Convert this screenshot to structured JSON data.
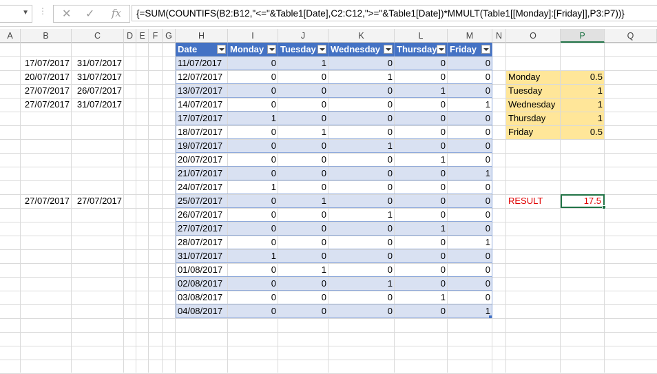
{
  "namebox": {
    "value": ""
  },
  "formula_bar": {
    "icons": [
      "cancel-icon",
      "enter-icon",
      "function-icon"
    ],
    "formula": "{=SUM(COUNTIFS(B2:B12,\"<=\"&Table1[Date],C2:C12,\">=\"&Table1[Date])*MMULT(Table1[[Monday]:[Friday]],P3:P7))}"
  },
  "columns": [
    "A",
    "B",
    "C",
    "D",
    "E",
    "F",
    "G",
    "H",
    "I",
    "J",
    "K",
    "L",
    "M",
    "N",
    "O",
    "P",
    "Q"
  ],
  "selected_column": "P",
  "ranges": [
    {
      "start": "17/07/2017",
      "end": "31/07/2017"
    },
    {
      "start": "20/07/2017",
      "end": "31/07/2017"
    },
    {
      "start": "27/07/2017",
      "end": "26/07/2017"
    },
    {
      "start": "27/07/2017",
      "end": "31/07/2017"
    },
    {
      "start": "27/07/2017",
      "end": "27/07/2017"
    }
  ],
  "table": {
    "headers": [
      "Date",
      "Monday",
      "Tuesday",
      "Wednesday",
      "Thursday",
      "Friday"
    ],
    "rows": [
      [
        "11/07/2017",
        "0",
        "1",
        "0",
        "0",
        "0"
      ],
      [
        "12/07/2017",
        "0",
        "0",
        "1",
        "0",
        "0"
      ],
      [
        "13/07/2017",
        "0",
        "0",
        "0",
        "1",
        "0"
      ],
      [
        "14/07/2017",
        "0",
        "0",
        "0",
        "0",
        "1"
      ],
      [
        "17/07/2017",
        "1",
        "0",
        "0",
        "0",
        "0"
      ],
      [
        "18/07/2017",
        "0",
        "1",
        "0",
        "0",
        "0"
      ],
      [
        "19/07/2017",
        "0",
        "0",
        "1",
        "0",
        "0"
      ],
      [
        "20/07/2017",
        "0",
        "0",
        "0",
        "1",
        "0"
      ],
      [
        "21/07/2017",
        "0",
        "0",
        "0",
        "0",
        "1"
      ],
      [
        "24/07/2017",
        "1",
        "0",
        "0",
        "0",
        "0"
      ],
      [
        "25/07/2017",
        "0",
        "1",
        "0",
        "0",
        "0"
      ],
      [
        "26/07/2017",
        "0",
        "0",
        "1",
        "0",
        "0"
      ],
      [
        "27/07/2017",
        "0",
        "0",
        "0",
        "1",
        "0"
      ],
      [
        "28/07/2017",
        "0",
        "0",
        "0",
        "0",
        "1"
      ],
      [
        "31/07/2017",
        "1",
        "0",
        "0",
        "0",
        "0"
      ],
      [
        "01/08/2017",
        "0",
        "1",
        "0",
        "0",
        "0"
      ],
      [
        "02/08/2017",
        "0",
        "0",
        "1",
        "0",
        "0"
      ],
      [
        "03/08/2017",
        "0",
        "0",
        "0",
        "1",
        "0"
      ],
      [
        "04/08/2017",
        "0",
        "0",
        "0",
        "0",
        "1"
      ]
    ]
  },
  "weights": [
    {
      "day": "Monday",
      "value": "0.5"
    },
    {
      "day": "Tuesday",
      "value": "1"
    },
    {
      "day": "Wednesday",
      "value": "1"
    },
    {
      "day": "Thursday",
      "value": "1"
    },
    {
      "day": "Friday",
      "value": "0.5"
    }
  ],
  "result": {
    "label": "RESULT",
    "value": "17.5"
  },
  "colors": {
    "table_header": "#4472c4",
    "band": "#d9e1f2",
    "weights_fill": "#ffe699",
    "result_text": "#e00000",
    "selection": "#217346"
  }
}
